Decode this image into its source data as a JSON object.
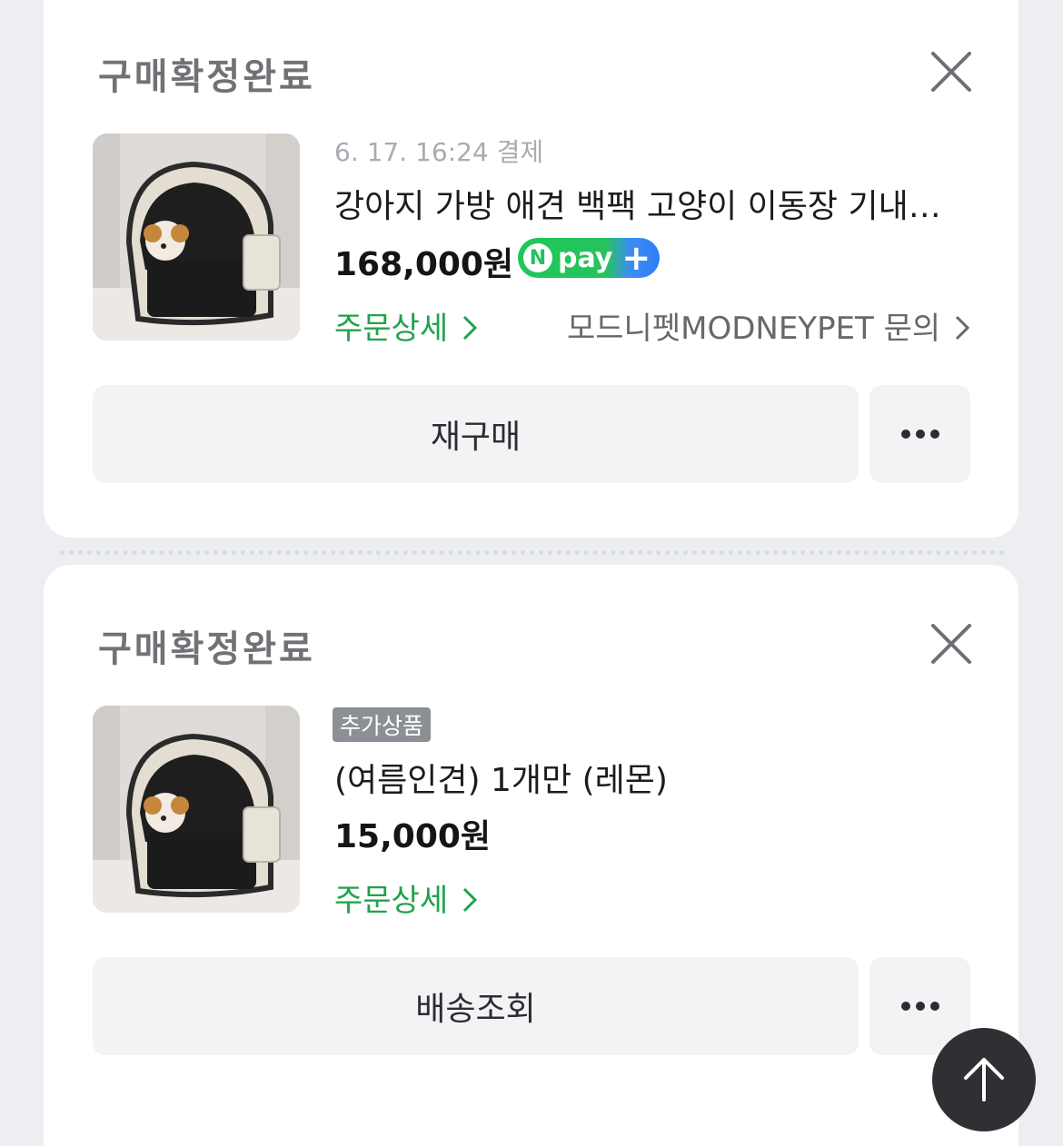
{
  "orders": [
    {
      "status": "구매확정완료",
      "meta": "6. 17. 16:24 결제",
      "product_name": "강아지 가방 애견 백팩 고양이 이동장 기내용 케리어",
      "price": "168,000원",
      "npay": {
        "n": "N",
        "text": "pay",
        "plus": "+"
      },
      "order_detail": "주문상세",
      "seller_inquiry": "모드니펫MODNEYPET 문의",
      "primary_action": "재구매",
      "more_icon": "more-horizontal-icon",
      "close_icon": "close-icon"
    },
    {
      "status": "구매확정완료",
      "tag": "추가상품",
      "product_name": "(여름인견) 1개만 (레몬)",
      "price": "15,000원",
      "order_detail": "주문상세",
      "primary_action": "배송조회",
      "more_icon": "more-horizontal-icon",
      "close_icon": "close-icon"
    }
  ],
  "scroll_top_icon": "arrow-up-icon",
  "colors": {
    "accent_green": "#1fa34b",
    "background": "#eceef2",
    "button_bg": "#f2f3f5",
    "fab_bg": "#2f3033"
  }
}
